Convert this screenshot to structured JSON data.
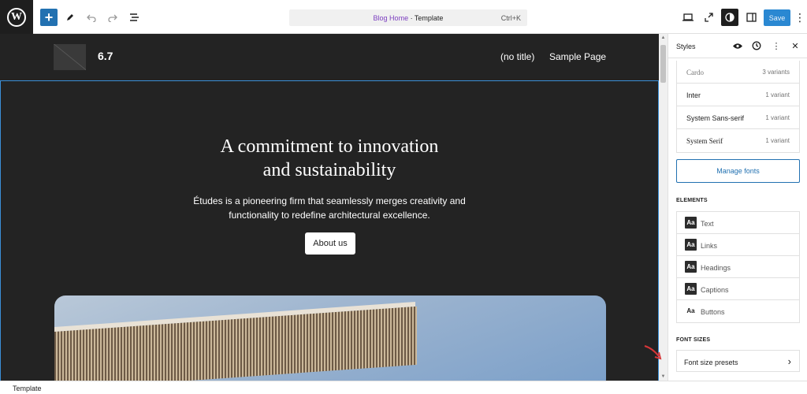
{
  "toolbar": {
    "logo_icon": "wordpress-logo-icon",
    "command": {
      "title": "Blog Home",
      "separator": " · ",
      "type": "Template",
      "shortcut": "Ctrl+K"
    },
    "save_label": "Save"
  },
  "canvas": {
    "site_title": "6.7",
    "nav": [
      "(no title)",
      "Sample Page"
    ],
    "headline": "A commitment to innovation\nand sustainability",
    "tagline": "Études is a pioneering firm that seamlessly merges creativity and\nfunctionality to redefine architectural excellence.",
    "button_label": "About us"
  },
  "panel": {
    "title": "Styles",
    "fonts": [
      {
        "name": "Cardo",
        "variants": "3 variants"
      },
      {
        "name": "Inter",
        "variants": "1 variant"
      },
      {
        "name": "System Sans-serif",
        "variants": "1 variant"
      },
      {
        "name": "System Serif",
        "variants": "1 variant"
      }
    ],
    "manage_fonts": "Manage fonts",
    "elements_heading": "ELEMENTS",
    "elements": [
      {
        "aa": "Aa",
        "label": "Text"
      },
      {
        "aa": "Aa",
        "label": "Links"
      },
      {
        "aa": "Aa",
        "label": "Headings"
      },
      {
        "aa": "Aa",
        "label": "Captions"
      },
      {
        "aa": "Aa",
        "label": "Buttons"
      }
    ],
    "font_sizes_heading": "FONT SIZES",
    "font_size_presets": "Font size presets"
  },
  "footer": {
    "breadcrumb": "Template"
  },
  "colors": {
    "accent": "#2271b1",
    "canvas_bg": "#232323",
    "annotation_arrow": "#d63638"
  }
}
